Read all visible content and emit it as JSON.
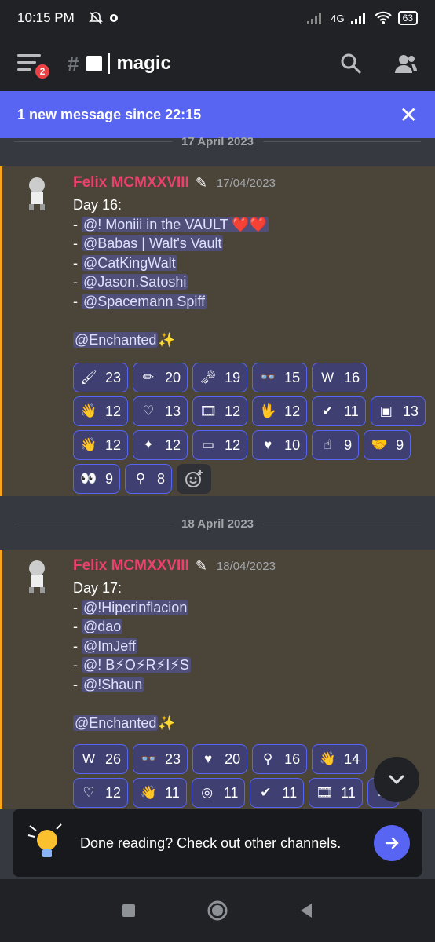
{
  "status": {
    "time": "10:15 PM",
    "network": "4G",
    "battery": "63"
  },
  "header": {
    "notif_count": "2",
    "channel_name": "magic"
  },
  "banner": {
    "text": "1 new message since 22:15",
    "close_glyph": "✕"
  },
  "messages": [
    {
      "date_divider": "17 April 2023",
      "author": "Felix MCMXXVIII",
      "timestamp": "17/04/2023",
      "lines": [
        {
          "prefix": "Day 16:",
          "mention": ""
        },
        {
          "prefix": "- ",
          "mention": "@! Moniii in the VAULT ❤️❤️"
        },
        {
          "prefix": "- ",
          "mention": "@Babas | Walt's Vault"
        },
        {
          "prefix": "- ",
          "mention": "@CatKingWalt"
        },
        {
          "prefix": "- ",
          "mention": "@Jason.Satoshi"
        },
        {
          "prefix": "- ",
          "mention": "@Spacemann Spiff"
        },
        {
          "prefix": "",
          "mention": ""
        },
        {
          "prefix": "",
          "mention": "@Enchanted",
          "suffix": "✨"
        }
      ],
      "reactions": [
        {
          "icon": "brush-icon",
          "glyph": "🖌",
          "count": "23"
        },
        {
          "icon": "pencil-icon",
          "glyph": "✏",
          "count": "20"
        },
        {
          "icon": "key-icon",
          "glyph": "🗝",
          "count": "19"
        },
        {
          "icon": "eyes-mask-icon",
          "glyph": "👓",
          "count": "15"
        },
        {
          "icon": "wv-logo-icon",
          "glyph": "W",
          "count": "16"
        },
        {
          "icon": "wave-hand-icon",
          "glyph": "👋",
          "count": "12"
        },
        {
          "icon": "heart-icon",
          "glyph": "♡",
          "count": "13"
        },
        {
          "icon": "film-icon",
          "glyph": "🎞",
          "count": "12"
        },
        {
          "icon": "vulcan-hand-icon",
          "glyph": "🖖",
          "count": "12"
        },
        {
          "icon": "check-badge-icon",
          "glyph": "✔",
          "count": "11"
        },
        {
          "icon": "walts-vault-icon",
          "glyph": "▣",
          "count": "13"
        },
        {
          "icon": "waving-hand-icon",
          "glyph": "👋",
          "count": "12"
        },
        {
          "icon": "sparkle-icon",
          "glyph": "✦",
          "count": "12"
        },
        {
          "icon": "frames-icon",
          "glyph": "▭",
          "count": "12"
        },
        {
          "icon": "heart-arrow-icon",
          "glyph": "♥",
          "count": "10"
        },
        {
          "icon": "point-hand-icon",
          "glyph": "☝",
          "count": "9"
        },
        {
          "icon": "handshake-icon",
          "glyph": "🤝",
          "count": "9"
        },
        {
          "icon": "eyes-icon",
          "glyph": "👀",
          "count": "9"
        },
        {
          "icon": "net-icon",
          "glyph": "⚲",
          "count": "8"
        }
      ]
    },
    {
      "date_divider": "18 April 2023",
      "author": "Felix MCMXXVIII",
      "timestamp": "18/04/2023",
      "lines": [
        {
          "prefix": "Day 17:",
          "mention": ""
        },
        {
          "prefix": "- ",
          "mention": "@!Hiperinflacion"
        },
        {
          "prefix": "- ",
          "mention": "@dao"
        },
        {
          "prefix": "- ",
          "mention": "@ImJeff"
        },
        {
          "prefix": "- ",
          "mention": "@! B⚡O⚡R⚡I⚡S"
        },
        {
          "prefix": "- ",
          "mention": "@!Shaun"
        },
        {
          "prefix": "",
          "mention": ""
        },
        {
          "prefix": "",
          "mention": "@Enchanted",
          "suffix": "✨"
        }
      ],
      "reactions": [
        {
          "icon": "wv-logo-icon",
          "glyph": "W",
          "count": "26"
        },
        {
          "icon": "eyes-mask-icon",
          "glyph": "👓",
          "count": "23"
        },
        {
          "icon": "heart-arrow-icon",
          "glyph": "♥",
          "count": "20"
        },
        {
          "icon": "net-icon",
          "glyph": "⚲",
          "count": "16"
        },
        {
          "icon": "wave-hand-icon",
          "glyph": "👋",
          "count": "14"
        },
        {
          "icon": "heart-icon",
          "glyph": "♡",
          "count": "12"
        },
        {
          "icon": "waving-hand-icon",
          "glyph": "👋",
          "count": "11"
        },
        {
          "icon": "spiral-icon",
          "glyph": "◎",
          "count": "11"
        },
        {
          "icon": "check-badge-icon",
          "glyph": "✔",
          "count": "11"
        },
        {
          "icon": "film-icon",
          "glyph": "🎞",
          "count": "11"
        },
        {
          "icon": "frames-icon",
          "glyph": "▭",
          "count": ""
        }
      ]
    }
  ],
  "done_reading": {
    "text": "Done reading? Check out other channels."
  },
  "colors": {
    "accent": "#5865f2",
    "author": "#e9426c",
    "highlight_bar": "#faa61a"
  }
}
